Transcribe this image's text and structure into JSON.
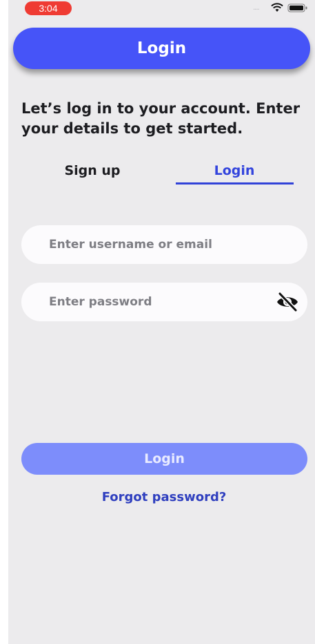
{
  "status_bar": {
    "time": "3:04",
    "signal_text": "....",
    "icons": [
      "wifi-icon",
      "battery-icon"
    ]
  },
  "header": {
    "title": "Login"
  },
  "intro": {
    "text": "Let’s log in to your account. Enter your details to get started."
  },
  "tabs": [
    {
      "label": "Sign up",
      "active": false
    },
    {
      "label": "Login",
      "active": true
    }
  ],
  "form": {
    "username": {
      "value": "",
      "placeholder": "Enter username or email"
    },
    "password": {
      "value": "",
      "placeholder": "Enter password",
      "toggle_icon": "eye-off-icon"
    }
  },
  "actions": {
    "login_label": "Login",
    "forgot_label": "Forgot password?"
  },
  "colors": {
    "primary": "#4654f8",
    "primary_disabled": "#7d8dfb",
    "link": "#2f3fbf",
    "background": "#ecebed",
    "field_background": "#fcfbfd",
    "status_pill": "#ef3b33"
  }
}
